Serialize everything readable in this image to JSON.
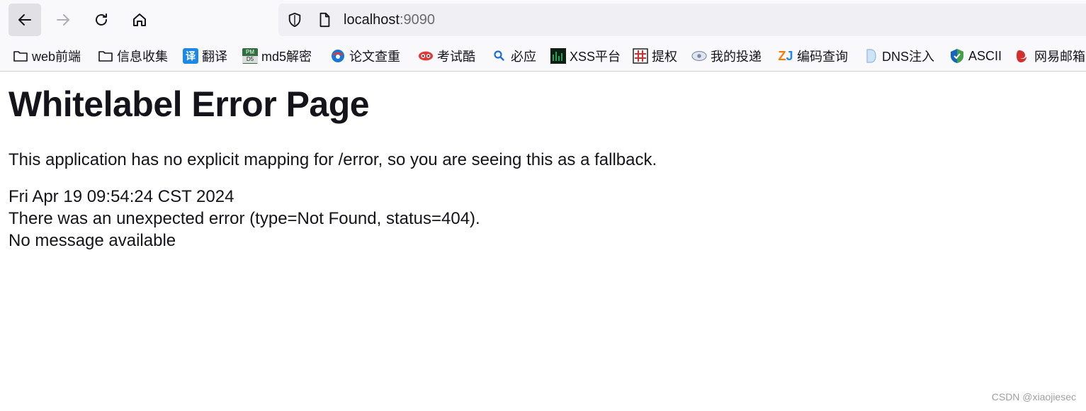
{
  "toolbar": {
    "url_host": "localhost",
    "url_port": ":9090"
  },
  "bookmarks": [
    {
      "label": "web前端",
      "icon": "folder-icon"
    },
    {
      "label": "信息收集",
      "icon": "folder-icon"
    },
    {
      "label": "翻译",
      "icon": "translate-icon"
    },
    {
      "label": "md5解密",
      "icon": "pmd5-icon"
    },
    {
      "label": "论文查重",
      "icon": "globe-icon"
    },
    {
      "label": "考试酷",
      "icon": "eyes-icon"
    },
    {
      "label": "必应",
      "icon": "bing-search-icon"
    },
    {
      "label": "XSS平台",
      "icon": "xss-icon"
    },
    {
      "label": "提权",
      "icon": "grid-icon"
    },
    {
      "label": "我的投递",
      "icon": "mail-eye-icon"
    },
    {
      "label": "编码查询",
      "icon": "zj-icon"
    },
    {
      "label": "DNS注入",
      "icon": "dns-icon"
    },
    {
      "label": "ASCII",
      "icon": "shield-logo-icon"
    },
    {
      "label": "网易邮箱",
      "icon": "netease-icon"
    }
  ],
  "page": {
    "title": "Whitelabel Error Page",
    "description": "This application has no explicit mapping for /error, so you are seeing this as a fallback.",
    "timestamp": "Fri Apr 19 09:54:24 CST 2024",
    "error": "There was an unexpected error (type=Not Found, status=404).",
    "message": "No message available"
  },
  "watermark": "CSDN @xiaojiesec"
}
